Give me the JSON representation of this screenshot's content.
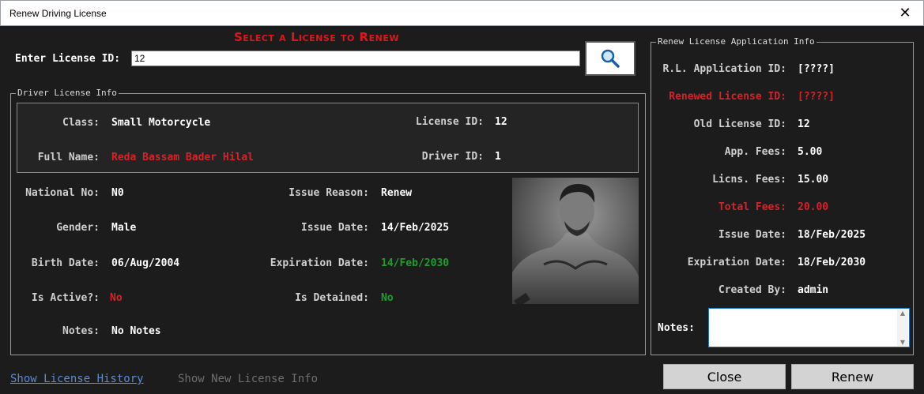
{
  "window": {
    "title": "Renew Driving License",
    "close_glyph": "✕"
  },
  "header": {
    "title": "Select a License to Renew"
  },
  "search": {
    "label": "Enter License ID:",
    "value": "12",
    "icon": "search-icon"
  },
  "driver_license_info": {
    "legend": "Driver License Info",
    "class_label": "Class:",
    "class_value": "Small Motorcycle",
    "license_id_label": "License ID:",
    "license_id_value": "12",
    "full_name_label": "Full Name:",
    "full_name_value": "Reda Bassam Bader Hilal",
    "driver_id_label": "Driver ID:",
    "driver_id_value": "1",
    "national_no_label": "National No:",
    "national_no_value": "N0",
    "issue_reason_label": "Issue Reason:",
    "issue_reason_value": "Renew",
    "gender_label": "Gender:",
    "gender_value": "Male",
    "issue_date_label": "Issue Date:",
    "issue_date_value": "14/Feb/2025",
    "birth_date_label": "Birth Date:",
    "birth_date_value": "06/Aug/2004",
    "expiration_date_label": "Expiration Date:",
    "expiration_date_value": "14/Feb/2030",
    "is_active_label": "Is Active?:",
    "is_active_value": "No",
    "is_detained_label": "Is Detained:",
    "is_detained_value": "No",
    "notes_label": "Notes:",
    "notes_value": "No Notes"
  },
  "renew_application_info": {
    "legend": "Renew License Application Info",
    "app_id_label": "R.L. Application ID:",
    "app_id_value": "[????]",
    "renewed_id_label": "Renewed License ID:",
    "renewed_id_value": "[????]",
    "old_id_label": "Old License ID:",
    "old_id_value": "12",
    "app_fees_label": "App. Fees:",
    "app_fees_value": "5.00",
    "license_fees_label": "Licns. Fees:",
    "license_fees_value": "15.00",
    "total_fees_label": "Total Fees:",
    "total_fees_value": "20.00",
    "issue_date_label": "Issue Date:",
    "issue_date_value": "18/Feb/2025",
    "expiration_date_label": "Expiration Date:",
    "expiration_date_value": "18/Feb/2030",
    "created_by_label": "Created By:",
    "created_by_value": "admin",
    "notes_label": "Notes:",
    "notes_value": ""
  },
  "links": {
    "history": "Show License History",
    "new_license": "Show New License Info"
  },
  "buttons": {
    "close": "Close",
    "renew": "Renew"
  },
  "colors": {
    "accent_red": "#d3242b",
    "accent_green": "#1f9d2e",
    "background": "#1c1c1c",
    "link_blue": "#5b8bd6"
  }
}
